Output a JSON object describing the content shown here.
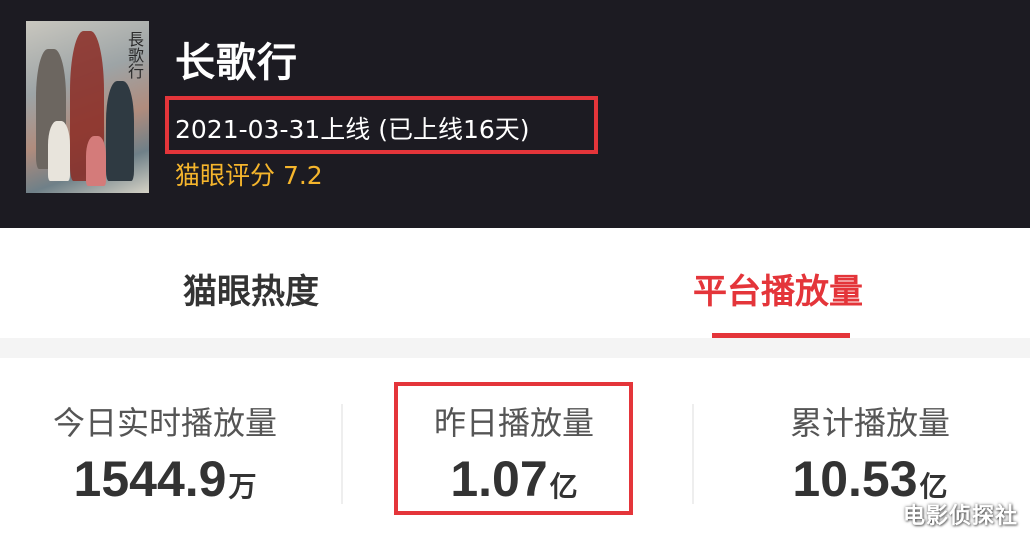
{
  "header": {
    "poster_calligraphy": "長歌行",
    "title": "长歌行",
    "release": "2021-03-31上线 (已上线16天)",
    "rating": "猫眼评分 7.2"
  },
  "tabs": [
    {
      "label": "猫眼热度",
      "active": false
    },
    {
      "label": "平台播放量",
      "active": true
    }
  ],
  "stats": [
    {
      "label": "今日实时播放量",
      "value": "1544.9",
      "unit": "万"
    },
    {
      "label": "昨日播放量",
      "value": "1.07",
      "unit": "亿"
    },
    {
      "label": "累计播放量",
      "value": "10.53",
      "unit": "亿"
    }
  ],
  "watermark": "电影侦探社",
  "colors": {
    "header_bg": "#1c1b22",
    "accent_red": "#e4353a",
    "rating_gold": "#f5b52c"
  }
}
